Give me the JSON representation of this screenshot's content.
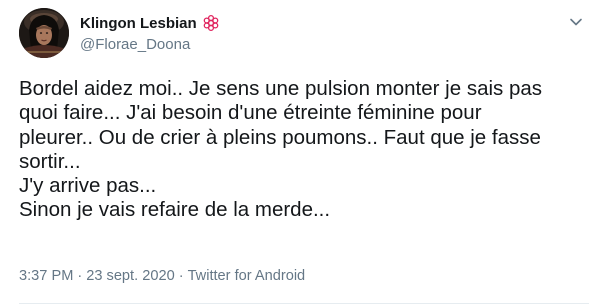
{
  "tweet": {
    "author": {
      "display_name": "Klingon Lesbian",
      "handle": "@Florae_Doona",
      "avatar_icon": "klingon-avatar-icon",
      "badge_icon": "flower-badge-icon"
    },
    "menu_icon": "chevron-down-icon",
    "text_lines": [
      "Bordel aidez moi.. Je sens une pulsion monter je sais pas",
      "quoi faire... J'ai besoin d'une étreinte féminine pour",
      "pleurer.. Ou de crier à pleins poumons.. Faut que je fasse",
      "sortir...",
      "J'y arrive pas...",
      "Sinon je vais refaire de la merde..."
    ],
    "meta": {
      "time": "3:37 PM",
      "separator": "·",
      "date": "23 sept. 2020",
      "source": "Twitter for Android"
    }
  },
  "colors": {
    "text_primary": "#14171a",
    "text_secondary": "#657786",
    "badge_pink": "#e0245e",
    "divider": "#e6ecf0"
  }
}
